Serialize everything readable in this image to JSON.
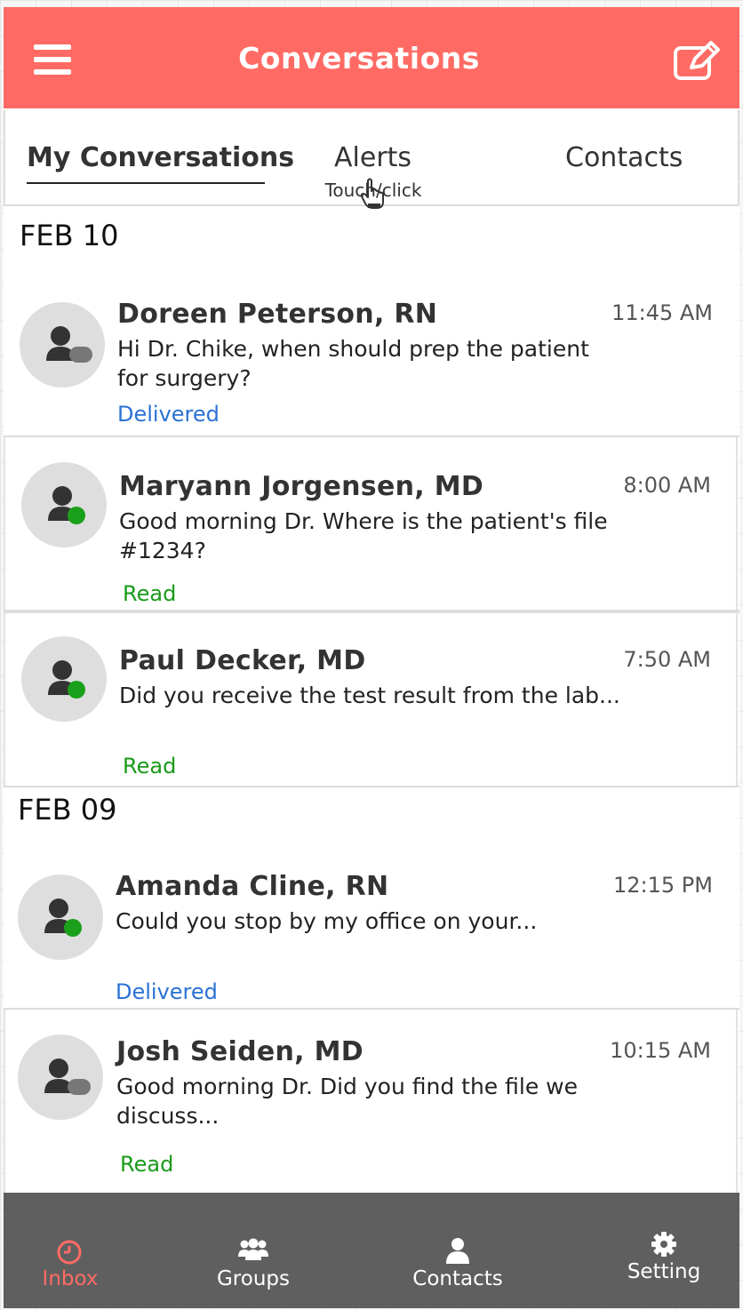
{
  "header": {
    "title": "Conversations",
    "menu_icon": "hamburger-menu-icon",
    "compose_icon": "compose-edit-icon"
  },
  "tabs": [
    {
      "label": "My Conversations",
      "active": true
    },
    {
      "label": "Alerts",
      "active": false
    },
    {
      "label": "Contacts",
      "active": false
    }
  ],
  "touch_hint": "Touch/click",
  "groups": [
    {
      "date": "FEB 10",
      "conversations": [
        {
          "name": "Doreen Peterson, RN",
          "time": "11:45 AM",
          "message": "Hi Dr. Chike, when should prep the patient for surgery?",
          "status": "Delivered",
          "presence": "offline"
        },
        {
          "name": "Maryann Jorgensen, MD",
          "time": "8:00 AM",
          "message": "Good morning Dr. Where is the patient's file #1234?",
          "status": "Read",
          "presence": "online"
        },
        {
          "name": "Paul Decker, MD",
          "time": "7:50 AM",
          "message": "Did you receive the test result from the lab...",
          "status": "Read",
          "presence": "online"
        }
      ]
    },
    {
      "date": "FEB 09",
      "conversations": [
        {
          "name": "Amanda Cline, RN",
          "time": "12:15 PM",
          "message": "Could you stop by my office on your...",
          "status": "Delivered",
          "presence": "online"
        },
        {
          "name": "Josh Seiden, MD",
          "time": "10:15 AM",
          "message": "Good morning Dr. Did you find the file we discuss...",
          "status": "Read",
          "presence": "offline"
        }
      ]
    }
  ],
  "bottom_nav": [
    {
      "label": "Inbox",
      "icon": "clock-icon",
      "active": true
    },
    {
      "label": "Groups",
      "icon": "group-icon",
      "active": false
    },
    {
      "label": "Contacts",
      "icon": "person-icon",
      "active": false
    },
    {
      "label": "Setting",
      "icon": "gear-icon",
      "active": false
    }
  ],
  "colors": {
    "accent": "#ff6b64",
    "delivered": "#2a72d4",
    "read": "#1a9a1a",
    "online": "#1aa01a",
    "offline": "#777777",
    "nav_bg": "#5f5f5f"
  }
}
